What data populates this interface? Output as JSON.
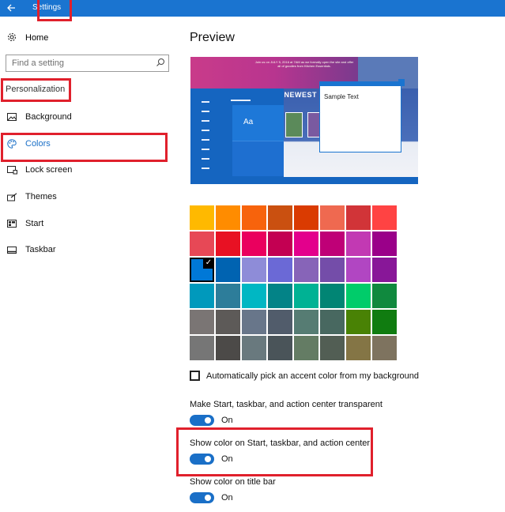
{
  "window": {
    "title": "Settings",
    "back_icon": "arrow-left-icon",
    "accent_color": "#1a74d0"
  },
  "sidebar": {
    "home_label": "Home",
    "search_placeholder": "Find a setting",
    "section_label": "Personalization",
    "items": [
      {
        "label": "Background",
        "icon": "picture-icon",
        "active": false
      },
      {
        "label": "Colors",
        "icon": "palette-icon",
        "active": true
      },
      {
        "label": "Lock screen",
        "icon": "lock-screen-icon",
        "active": false
      },
      {
        "label": "Themes",
        "icon": "themes-icon",
        "active": false
      },
      {
        "label": "Start",
        "icon": "start-icon",
        "active": false
      },
      {
        "label": "Taskbar",
        "icon": "taskbar-icon",
        "active": false
      }
    ]
  },
  "main": {
    "preview_title": "Preview",
    "preview": {
      "tile_label": "Aa",
      "sample_window_text": "Sample Text",
      "banner_text": "Join us on JULY 5, 2016 at 7AM as we formally open the site and offer all of goodies from Kitchen Essentials.",
      "banner_heading": "5 NEWEST HO"
    },
    "accent_colors": [
      "#ffb900",
      "#ff8c00",
      "#f7630c",
      "#ca5010",
      "#da3b01",
      "#ef6950",
      "#d13438",
      "#ff4343",
      "#e74856",
      "#e81123",
      "#ea005e",
      "#c30052",
      "#e3008c",
      "#bf0077",
      "#c239b3",
      "#9a0089",
      "#0078d7",
      "#0063b1",
      "#8e8cd8",
      "#6b69d6",
      "#8764b8",
      "#744da9",
      "#b146c2",
      "#881798",
      "#0099bc",
      "#2d7d9a",
      "#00b7c3",
      "#038387",
      "#00b294",
      "#018574",
      "#00cc6a",
      "#10893e",
      "#7a7574",
      "#5d5a58",
      "#68768a",
      "#515c6b",
      "#567c73",
      "#486860",
      "#498205",
      "#107c10",
      "#767676",
      "#4c4a48",
      "#69797e",
      "#4a5459",
      "#647c64",
      "#525e54",
      "#847545",
      "#7e735f"
    ],
    "selected_color_index": 16,
    "auto_pick_label": "Automatically pick an accent color from my background",
    "auto_pick_checked": false,
    "options": [
      {
        "label": "Make Start, taskbar, and action center transparent",
        "state": "On"
      },
      {
        "label": "Show color on Start, taskbar, and action center",
        "state": "On"
      },
      {
        "label": "Show color on title bar",
        "state": "On"
      }
    ]
  }
}
